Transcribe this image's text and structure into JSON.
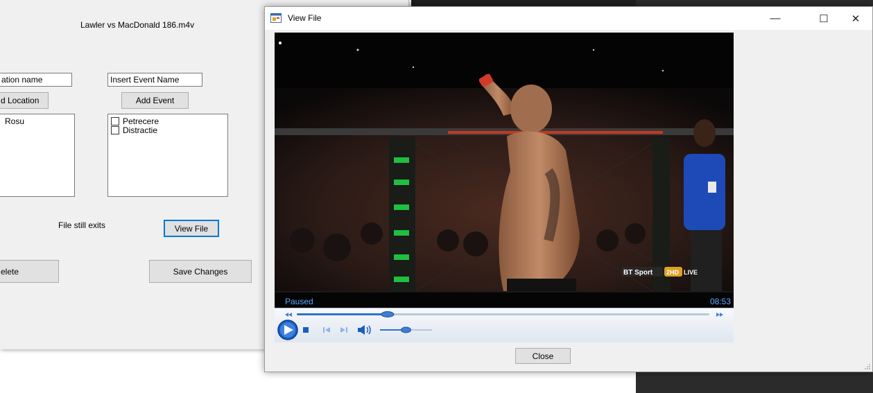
{
  "background_form": {
    "file_title": "Lawler vs MacDonald 186.m4v",
    "location_input_value": "ation name",
    "event_input_value": "Insert Event Name",
    "add_location_label": "d Location",
    "add_event_label": "Add Event",
    "locations": [
      "Rosu"
    ],
    "events": [
      {
        "label": "Petrecere",
        "checked": false
      },
      {
        "label": "Distractie",
        "checked": false
      }
    ],
    "file_status": "File still exits",
    "view_file_label": "View File",
    "delete_label": "elete",
    "save_changes_label": "Save Changes"
  },
  "view_window": {
    "title": "View File",
    "minimize_glyph": "—",
    "maximize_glyph": "☐",
    "close_glyph": "✕",
    "player": {
      "status": "Paused",
      "time": "08:53",
      "seek_progress": 0.22,
      "volume_level": 0.5,
      "broadcaster_logo": "BT Sport 2HD LIVE"
    },
    "close_button_label": "Close"
  },
  "colors": {
    "accent": "#0078d7",
    "status_text": "#5aa9ff",
    "seek_fill": "#2e73c9"
  },
  "icons": [
    "app-icon",
    "minimize-icon",
    "maximize-icon",
    "close-icon",
    "rewind-icon",
    "fast-forward-icon",
    "play-icon",
    "stop-icon",
    "previous-icon",
    "next-icon",
    "volume-icon"
  ]
}
